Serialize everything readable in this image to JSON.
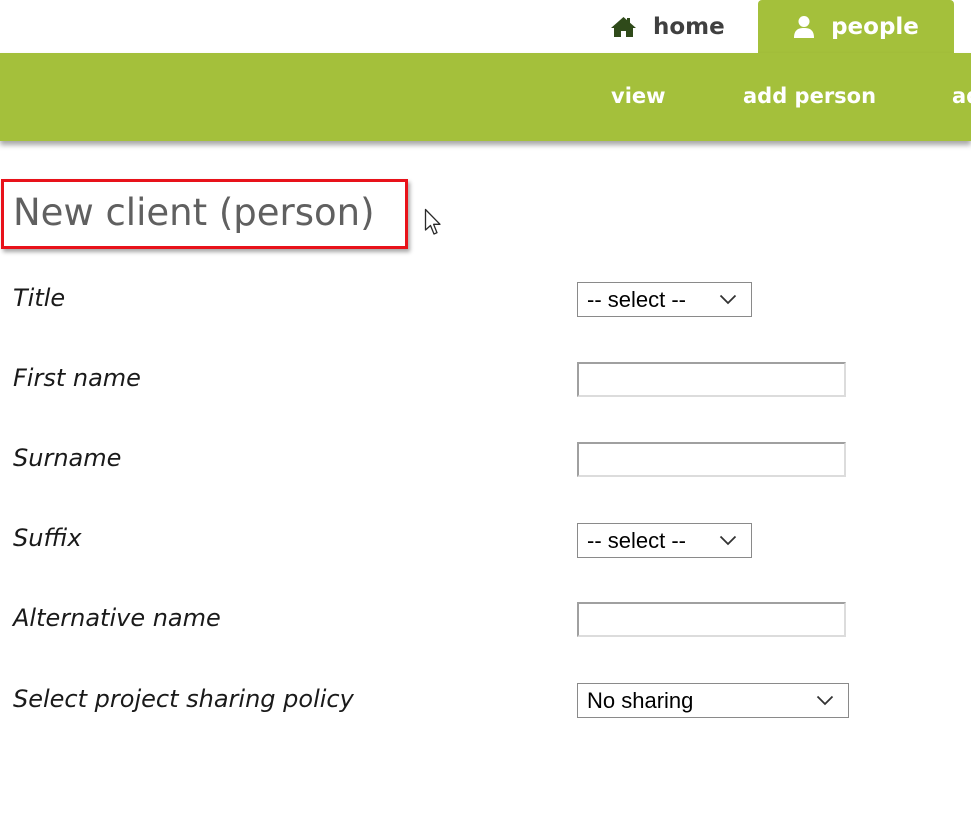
{
  "top_tabs": {
    "home": {
      "label": "home",
      "icon": "home-icon"
    },
    "people": {
      "label": "people",
      "icon": "user-icon",
      "active": true
    }
  },
  "sub_nav": {
    "view": "view",
    "add_person": "add person",
    "more_partial": "ad"
  },
  "page": {
    "heading": "New client (person)"
  },
  "form": {
    "title": {
      "label": "Title",
      "value": "-- select --"
    },
    "first_name": {
      "label": "First name",
      "value": ""
    },
    "surname": {
      "label": "Surname",
      "value": ""
    },
    "suffix": {
      "label": "Suffix",
      "value": "-- select --"
    },
    "alternative_name": {
      "label": "Alternative name",
      "value": ""
    },
    "sharing_policy": {
      "label": "Select project sharing policy",
      "value": "No sharing"
    }
  },
  "colors": {
    "accent_green": "#a4c03b",
    "highlight_red": "#e8121a",
    "home_icon": "#2f4a1a"
  }
}
